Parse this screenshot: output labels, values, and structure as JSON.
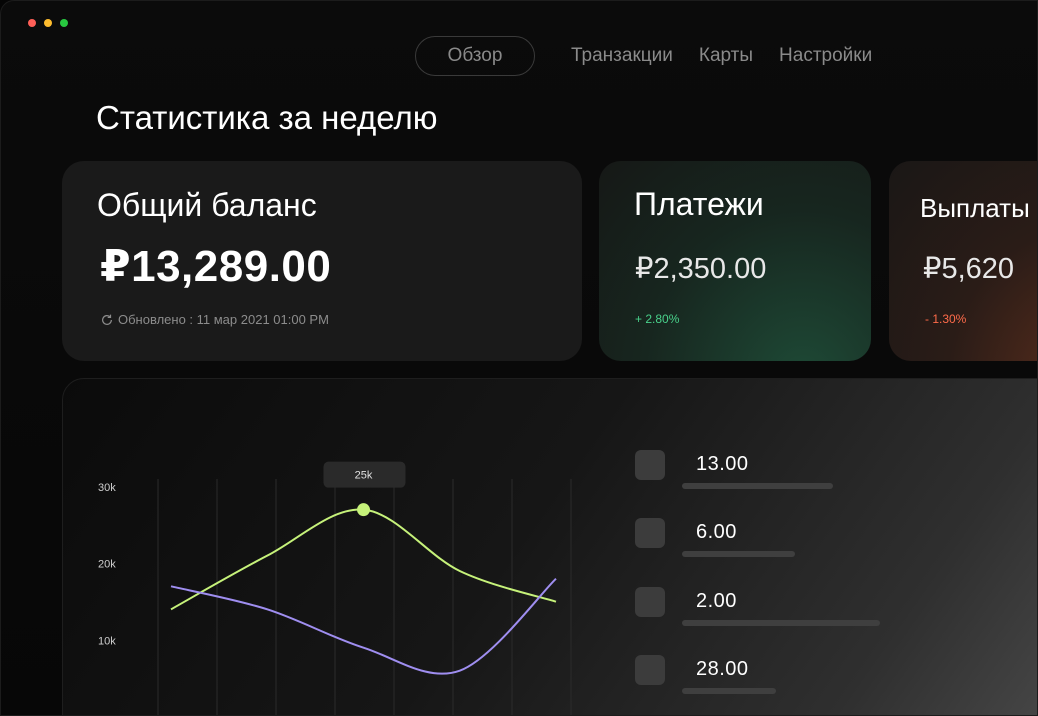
{
  "window": {
    "controls": [
      "close",
      "minimize",
      "maximize"
    ]
  },
  "nav": {
    "active": "Обзор",
    "links": [
      "Транзакции",
      "Карты",
      "Настройки"
    ]
  },
  "page": {
    "title": "Статистика за неделю"
  },
  "balance": {
    "title": "Общий баланс",
    "amount": "₽13,289.00",
    "updated": "Обновлено : 11 мар 2021 01:00 PM"
  },
  "payments": {
    "title": "Платежи",
    "amount": "₽2,350.00",
    "change": "+ 2.80%",
    "color": "#49d18b"
  },
  "payouts": {
    "title": "Выплаты",
    "amount": "₽5,620",
    "change": "- 1.30%",
    "color": "#ff6b4a"
  },
  "stats": {
    "items": [
      {
        "value": "13.00",
        "fill": 0.64
      },
      {
        "value": "6.00",
        "fill": 0.48
      },
      {
        "value": "2.00",
        "fill": 0.84
      },
      {
        "value": "28.00",
        "fill": 0.4
      }
    ]
  },
  "chart_data": {
    "type": "line",
    "yticks": [
      "30k",
      "20k",
      "10k"
    ],
    "ylim": [
      0,
      30
    ],
    "tooltip": "25k",
    "series": [
      {
        "color": "#c6f27a",
        "values": [
          13,
          20,
          26,
          18,
          14
        ]
      },
      {
        "color": "#9f8ef0",
        "values": [
          16,
          13,
          8,
          5,
          17
        ]
      }
    ],
    "grid": true
  }
}
